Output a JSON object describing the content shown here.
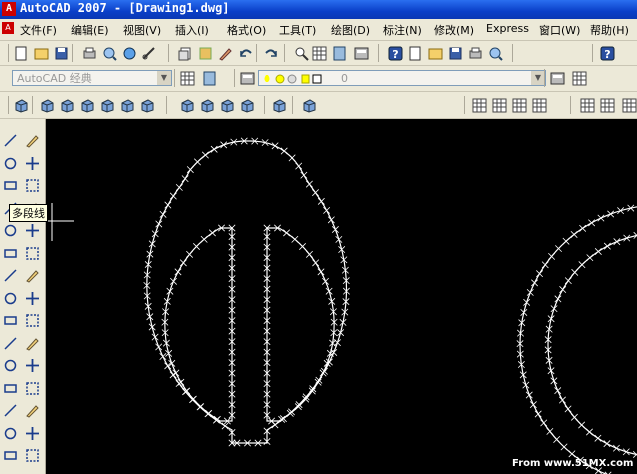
{
  "window": {
    "title": "AutoCAD 2007 - [Drawing1.dwg]",
    "app_icon": "autocad-icon"
  },
  "menu": [
    {
      "id": "file",
      "label": "文件(F)"
    },
    {
      "id": "edit",
      "label": "编辑(E)"
    },
    {
      "id": "view",
      "label": "视图(V)"
    },
    {
      "id": "insert",
      "label": "插入(I)"
    },
    {
      "id": "format",
      "label": "格式(O)"
    },
    {
      "id": "tools",
      "label": "工具(T)"
    },
    {
      "id": "draw",
      "label": "绘图(D)"
    },
    {
      "id": "dimension",
      "label": "标注(N)"
    },
    {
      "id": "modify",
      "label": "修改(M)"
    },
    {
      "id": "express",
      "label": "Express"
    },
    {
      "id": "window",
      "label": "窗口(W)"
    },
    {
      "id": "help",
      "label": "帮助(H)"
    }
  ],
  "workspace": {
    "value": "AutoCAD 经典"
  },
  "layer": {
    "value": "0"
  },
  "tooltip": {
    "text": "多段线"
  },
  "watermark": {
    "text": "From www.51MX.com"
  },
  "colors": {
    "canvas": "#000000",
    "title": "#0a3fc8",
    "chrome": "#ece9d8",
    "geometry": "#ffffff"
  }
}
